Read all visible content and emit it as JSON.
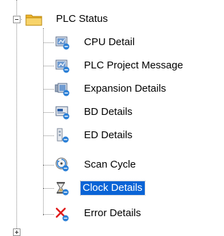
{
  "tree": {
    "root": {
      "label": "PLC Status",
      "icon": "folder-icon"
    },
    "items": [
      {
        "label": "CPU Detail",
        "icon": "cpu-detail-icon"
      },
      {
        "label": "PLC Project Message",
        "icon": "project-message-icon"
      },
      {
        "label": "Expansion Details",
        "icon": "expansion-details-icon"
      },
      {
        "label": "BD Details",
        "icon": "bd-details-icon"
      },
      {
        "label": "ED Details",
        "icon": "ed-details-icon"
      },
      {
        "label": "Scan Cycle",
        "icon": "scan-cycle-icon"
      },
      {
        "label": "Clock Details",
        "icon": "clock-details-icon",
        "selected": true
      },
      {
        "label": "Error Details",
        "icon": "error-details-icon"
      }
    ]
  },
  "colors": {
    "selection": "#0a64d6",
    "tree_line": "#8a8a8a",
    "folder": "#f5c542"
  }
}
